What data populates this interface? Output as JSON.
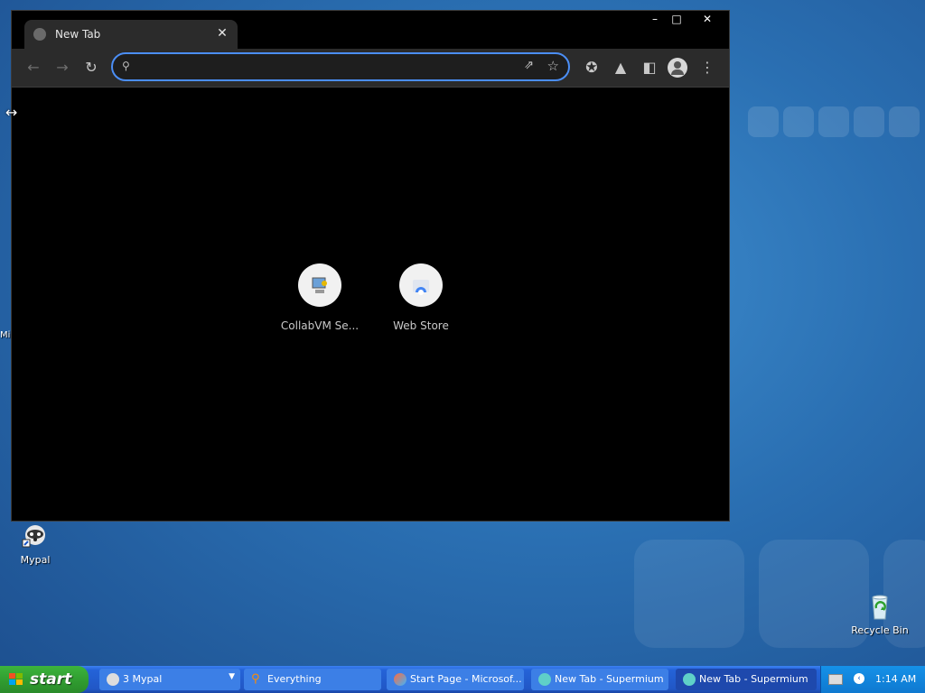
{
  "browser": {
    "tab_title": "New Tab",
    "address_value": "",
    "shortcuts": [
      {
        "label": "CollabVM Se..."
      },
      {
        "label": "Web Store"
      }
    ]
  },
  "desktop": {
    "icons": [
      {
        "label": "Mypal"
      },
      {
        "label": "Recycle Bin"
      }
    ],
    "edge_text": "Mi"
  },
  "taskbar": {
    "start_label": "start",
    "tasks": [
      {
        "label": "3 Mypal"
      },
      {
        "label": "Everything"
      },
      {
        "label": "Start Page - Microsof..."
      },
      {
        "label": "New Tab - Supermium"
      },
      {
        "label": "New Tab - Supermium"
      }
    ],
    "clock": "1:14 AM"
  }
}
